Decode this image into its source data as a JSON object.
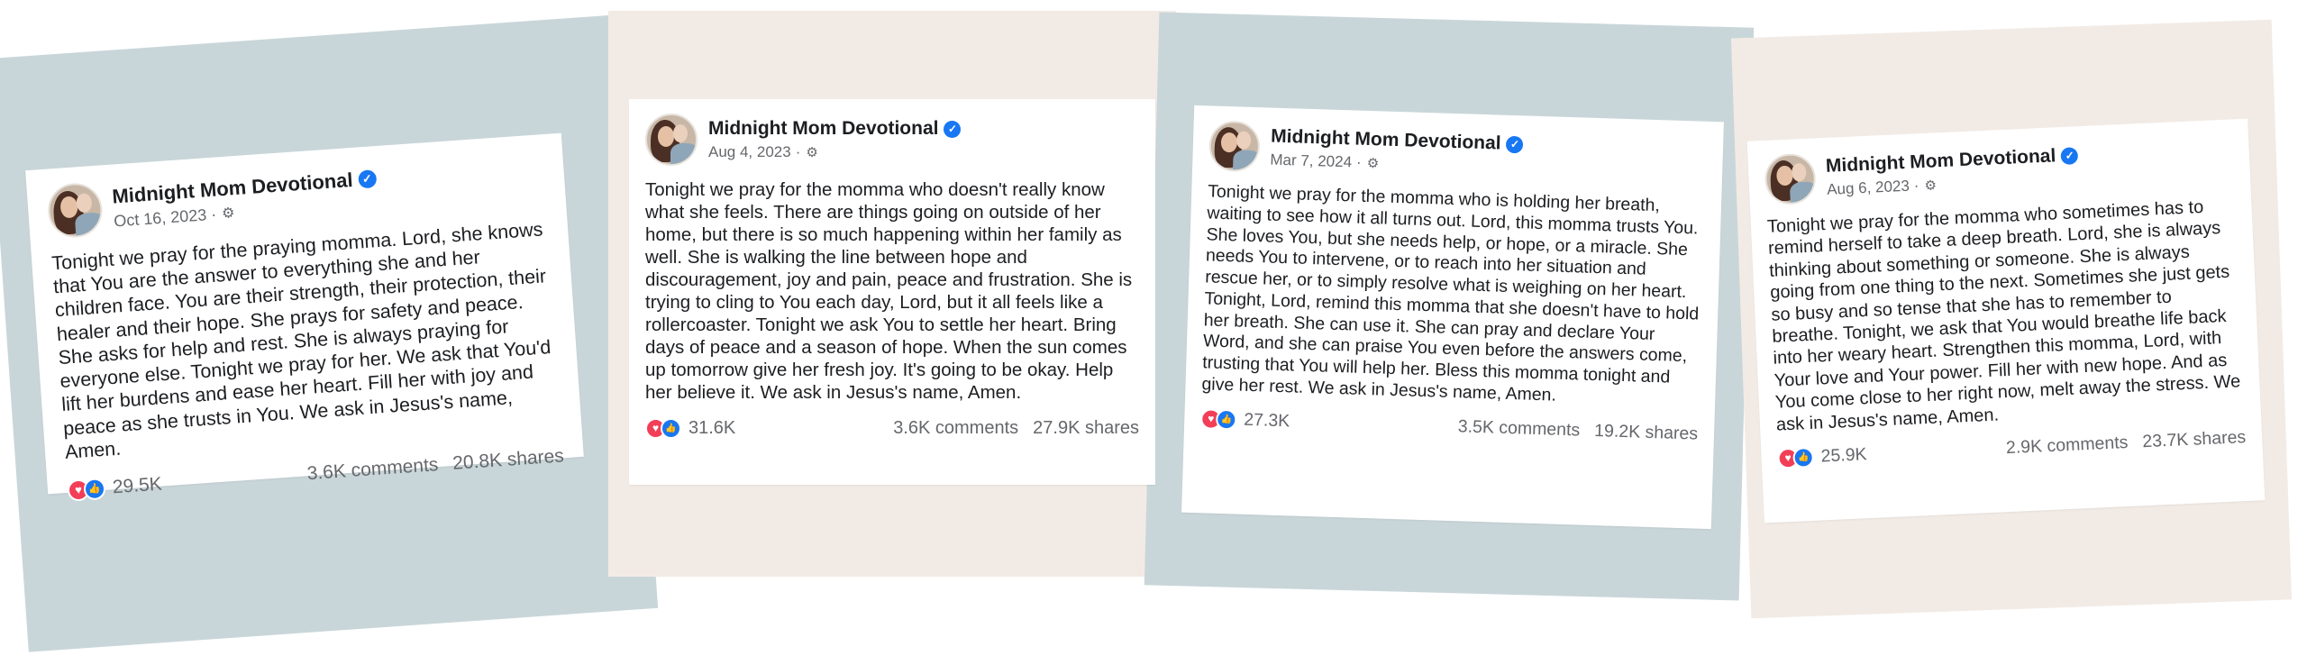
{
  "colors": {
    "panel_gray": "#c9d6d9",
    "panel_beige": "#f2ebe5",
    "verified_blue": "#1877f2",
    "heart_red": "#f33e58",
    "meta_gray": "#65676b"
  },
  "icons": {
    "verified": "✓",
    "settings": "⚙",
    "heart": "♥",
    "like": "👍"
  },
  "posts": [
    {
      "author": "Midnight Mom Devotional",
      "date": "Oct 16, 2023",
      "date_separator": "·",
      "text": "Tonight we pray for the praying momma. Lord, she knows that You are the answer to everything she and her children face. You are their strength, their protection, their healer and their hope. She prays for safety and peace. She asks for help and rest. She is always praying for everyone else. Tonight we pray for her. We ask that You'd lift her burdens and ease her heart. Fill her with joy and peace as she trusts in You. We ask in Jesus's name, Amen.",
      "reactions": "29.5K",
      "comments": "3.6K comments",
      "shares": "20.8K shares"
    },
    {
      "author": "Midnight Mom Devotional",
      "date": "Aug 4, 2023",
      "date_separator": "·",
      "text": "Tonight we pray for the momma who doesn't really know what she feels. There are things going on outside of her home, but there is so much happening within her family as well. She is walking the line between hope and discouragement, joy and pain, peace and frustration. She is trying to cling to You each day, Lord, but it all feels like a rollercoaster. Tonight we ask You to settle her heart. Bring days of peace and a season of hope. When the sun comes up tomorrow give her fresh joy. It's going to be okay. Help her believe it. We ask in Jesus's name, Amen.",
      "reactions": "31.6K",
      "comments": "3.6K comments",
      "shares": "27.9K shares"
    },
    {
      "author": "Midnight Mom Devotional",
      "date": "Mar 7, 2024",
      "date_separator": "·",
      "text": "Tonight we pray for the momma who is holding her breath, waiting to see how it all turns out. Lord, this momma trusts You. She loves You, but she needs help, or hope, or a miracle. She needs You to intervene, or to reach into her situation and rescue her, or to simply resolve what is weighing on her heart. Tonight, Lord, remind this momma that she doesn't have to hold her breath. She can use it. She can pray and declare Your Word, and she can praise You even before the answers come, trusting that You will help her. Bless this momma tonight and give her rest. We ask in Jesus's name, Amen.",
      "reactions": "27.3K",
      "comments": "3.5K comments",
      "shares": "19.2K shares"
    },
    {
      "author": "Midnight Mom Devotional",
      "date": "Aug 6, 2023",
      "date_separator": "·",
      "text": "Tonight we pray for the momma who sometimes has to remind herself to take a deep breath. Lord, she is always thinking about something or someone. She is always going from one thing to the next. Sometimes she just gets so busy and so tense that she has to remember to breathe. Tonight, we ask that You would breathe life back into her weary heart. Strengthen this momma, Lord, with Your love and Your power. Fill her with new hope. And as You come close to her right now, melt away the stress. We ask in Jesus's name, Amen.",
      "reactions": "25.9K",
      "comments": "2.9K comments",
      "shares": "23.7K shares"
    }
  ]
}
